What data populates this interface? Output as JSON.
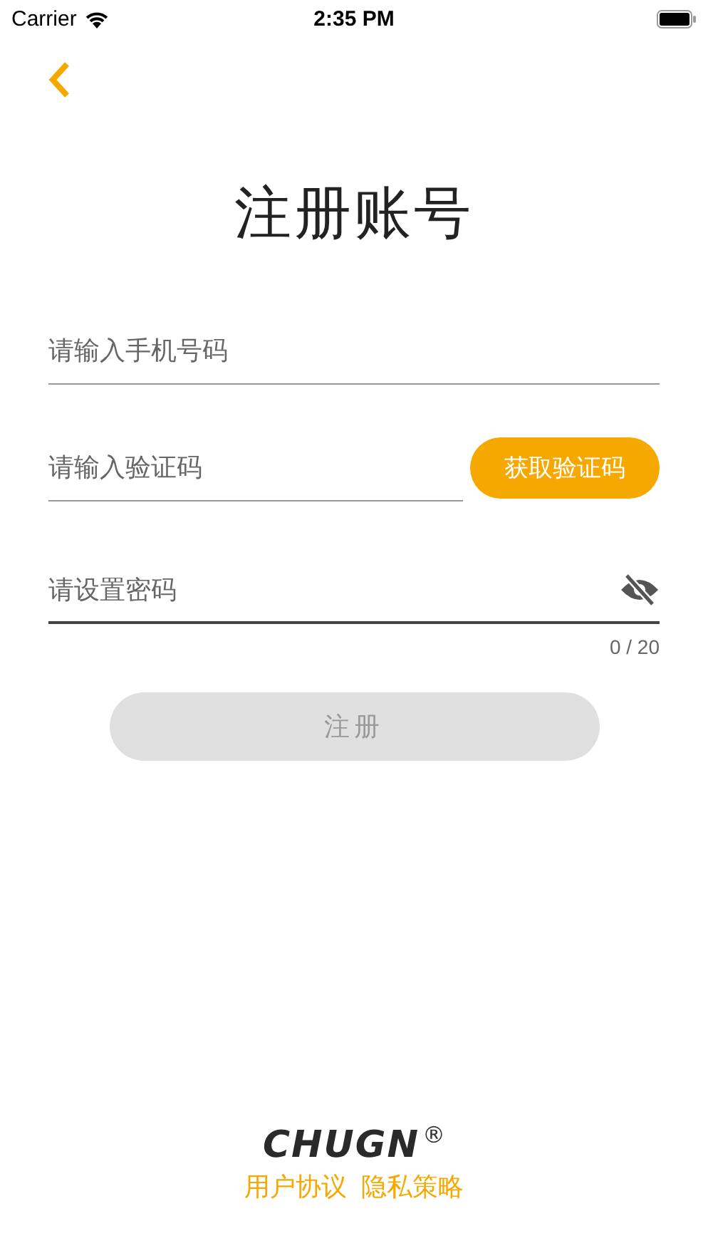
{
  "status_bar": {
    "carrier": "Carrier",
    "time": "2:35 PM"
  },
  "title": "注册账号",
  "phone_field": {
    "placeholder": "请输入手机号码"
  },
  "code_field": {
    "placeholder": "请输入验证码"
  },
  "get_code_button": {
    "label": "获取验证码"
  },
  "password_field": {
    "placeholder": "请设置密码",
    "password_visible": false,
    "counter": "0 / 20"
  },
  "register_button": {
    "label": "注册",
    "disabled": true
  },
  "footer": {
    "logo": "CHUGN",
    "registered_mark": "®",
    "links": [
      {
        "label": "用户协议"
      },
      {
        "label": "隐私策略"
      }
    ]
  }
}
